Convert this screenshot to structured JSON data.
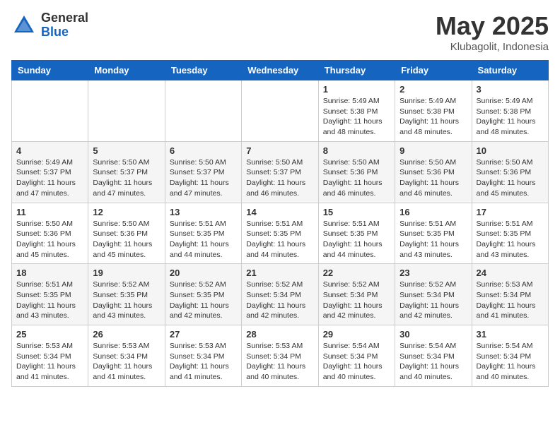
{
  "header": {
    "logo_general": "General",
    "logo_blue": "Blue",
    "month_title": "May 2025",
    "location": "Klubagolit, Indonesia"
  },
  "weekdays": [
    "Sunday",
    "Monday",
    "Tuesday",
    "Wednesday",
    "Thursday",
    "Friday",
    "Saturday"
  ],
  "weeks": [
    [
      {
        "day": "",
        "info": ""
      },
      {
        "day": "",
        "info": ""
      },
      {
        "day": "",
        "info": ""
      },
      {
        "day": "",
        "info": ""
      },
      {
        "day": "1",
        "info": "Sunrise: 5:49 AM\nSunset: 5:38 PM\nDaylight: 11 hours\nand 48 minutes."
      },
      {
        "day": "2",
        "info": "Sunrise: 5:49 AM\nSunset: 5:38 PM\nDaylight: 11 hours\nand 48 minutes."
      },
      {
        "day": "3",
        "info": "Sunrise: 5:49 AM\nSunset: 5:38 PM\nDaylight: 11 hours\nand 48 minutes."
      }
    ],
    [
      {
        "day": "4",
        "info": "Sunrise: 5:49 AM\nSunset: 5:37 PM\nDaylight: 11 hours\nand 47 minutes."
      },
      {
        "day": "5",
        "info": "Sunrise: 5:50 AM\nSunset: 5:37 PM\nDaylight: 11 hours\nand 47 minutes."
      },
      {
        "day": "6",
        "info": "Sunrise: 5:50 AM\nSunset: 5:37 PM\nDaylight: 11 hours\nand 47 minutes."
      },
      {
        "day": "7",
        "info": "Sunrise: 5:50 AM\nSunset: 5:37 PM\nDaylight: 11 hours\nand 46 minutes."
      },
      {
        "day": "8",
        "info": "Sunrise: 5:50 AM\nSunset: 5:36 PM\nDaylight: 11 hours\nand 46 minutes."
      },
      {
        "day": "9",
        "info": "Sunrise: 5:50 AM\nSunset: 5:36 PM\nDaylight: 11 hours\nand 46 minutes."
      },
      {
        "day": "10",
        "info": "Sunrise: 5:50 AM\nSunset: 5:36 PM\nDaylight: 11 hours\nand 45 minutes."
      }
    ],
    [
      {
        "day": "11",
        "info": "Sunrise: 5:50 AM\nSunset: 5:36 PM\nDaylight: 11 hours\nand 45 minutes."
      },
      {
        "day": "12",
        "info": "Sunrise: 5:50 AM\nSunset: 5:36 PM\nDaylight: 11 hours\nand 45 minutes."
      },
      {
        "day": "13",
        "info": "Sunrise: 5:51 AM\nSunset: 5:35 PM\nDaylight: 11 hours\nand 44 minutes."
      },
      {
        "day": "14",
        "info": "Sunrise: 5:51 AM\nSunset: 5:35 PM\nDaylight: 11 hours\nand 44 minutes."
      },
      {
        "day": "15",
        "info": "Sunrise: 5:51 AM\nSunset: 5:35 PM\nDaylight: 11 hours\nand 44 minutes."
      },
      {
        "day": "16",
        "info": "Sunrise: 5:51 AM\nSunset: 5:35 PM\nDaylight: 11 hours\nand 43 minutes."
      },
      {
        "day": "17",
        "info": "Sunrise: 5:51 AM\nSunset: 5:35 PM\nDaylight: 11 hours\nand 43 minutes."
      }
    ],
    [
      {
        "day": "18",
        "info": "Sunrise: 5:51 AM\nSunset: 5:35 PM\nDaylight: 11 hours\nand 43 minutes."
      },
      {
        "day": "19",
        "info": "Sunrise: 5:52 AM\nSunset: 5:35 PM\nDaylight: 11 hours\nand 43 minutes."
      },
      {
        "day": "20",
        "info": "Sunrise: 5:52 AM\nSunset: 5:35 PM\nDaylight: 11 hours\nand 42 minutes."
      },
      {
        "day": "21",
        "info": "Sunrise: 5:52 AM\nSunset: 5:34 PM\nDaylight: 11 hours\nand 42 minutes."
      },
      {
        "day": "22",
        "info": "Sunrise: 5:52 AM\nSunset: 5:34 PM\nDaylight: 11 hours\nand 42 minutes."
      },
      {
        "day": "23",
        "info": "Sunrise: 5:52 AM\nSunset: 5:34 PM\nDaylight: 11 hours\nand 42 minutes."
      },
      {
        "day": "24",
        "info": "Sunrise: 5:53 AM\nSunset: 5:34 PM\nDaylight: 11 hours\nand 41 minutes."
      }
    ],
    [
      {
        "day": "25",
        "info": "Sunrise: 5:53 AM\nSunset: 5:34 PM\nDaylight: 11 hours\nand 41 minutes."
      },
      {
        "day": "26",
        "info": "Sunrise: 5:53 AM\nSunset: 5:34 PM\nDaylight: 11 hours\nand 41 minutes."
      },
      {
        "day": "27",
        "info": "Sunrise: 5:53 AM\nSunset: 5:34 PM\nDaylight: 11 hours\nand 41 minutes."
      },
      {
        "day": "28",
        "info": "Sunrise: 5:53 AM\nSunset: 5:34 PM\nDaylight: 11 hours\nand 40 minutes."
      },
      {
        "day": "29",
        "info": "Sunrise: 5:54 AM\nSunset: 5:34 PM\nDaylight: 11 hours\nand 40 minutes."
      },
      {
        "day": "30",
        "info": "Sunrise: 5:54 AM\nSunset: 5:34 PM\nDaylight: 11 hours\nand 40 minutes."
      },
      {
        "day": "31",
        "info": "Sunrise: 5:54 AM\nSunset: 5:34 PM\nDaylight: 11 hours\nand 40 minutes."
      }
    ]
  ]
}
